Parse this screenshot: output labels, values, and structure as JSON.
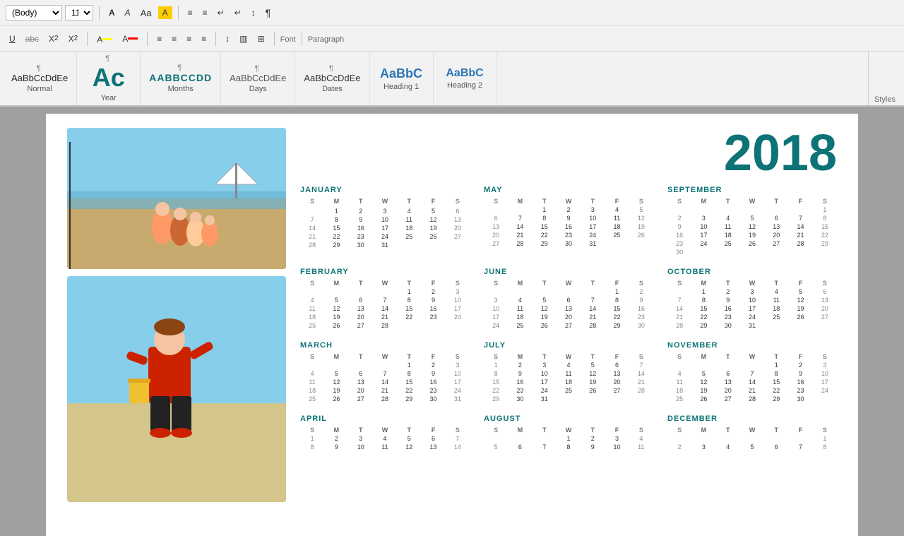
{
  "toolbar": {
    "font_family": "(Body)",
    "font_size": "11",
    "styles_label": "Styles",
    "font_label": "Font",
    "paragraph_label": "Paragraph"
  },
  "styles": [
    {
      "id": "normal",
      "preview_text": "¶ Normal",
      "label": "Normal",
      "class": "style-preview-normal"
    },
    {
      "id": "year",
      "preview_text": "¶ Year",
      "label": "Year",
      "class": "style-preview-year"
    },
    {
      "id": "months",
      "preview_text": "¶ Months",
      "label": "Months",
      "class": "style-preview-months"
    },
    {
      "id": "days",
      "preview_text": "¶ Days",
      "label": "Days",
      "class": "style-preview-days"
    },
    {
      "id": "dates",
      "preview_text": "¶ Dates",
      "label": "Dates",
      "class": "style-preview-dates"
    },
    {
      "id": "heading1",
      "preview_text": "AaBbCc",
      "label": "Heading 1",
      "class": "style-preview-heading1"
    },
    {
      "id": "heading2",
      "preview_text": "AaBbCc",
      "label": "Heading 2",
      "class": "style-preview-heading2"
    }
  ],
  "year": "2018",
  "months": [
    {
      "name": "JANUARY",
      "days": [
        "S",
        "M",
        "T",
        "W",
        "T",
        "F",
        "S"
      ],
      "weeks": [
        [
          "",
          "",
          "",
          "",
          "",
          "",
          ""
        ],
        [
          "",
          "1",
          "2",
          "3",
          "4",
          "5",
          "6"
        ],
        [
          "7",
          "8",
          "9",
          "10",
          "11",
          "12",
          "13"
        ],
        [
          "14",
          "15",
          "16",
          "17",
          "18",
          "19",
          "20"
        ],
        [
          "21",
          "22",
          "23",
          "24",
          "25",
          "26",
          "27"
        ],
        [
          "28",
          "29",
          "30",
          "31",
          "",
          "",
          ""
        ]
      ]
    },
    {
      "name": "MAY",
      "days": [
        "S",
        "M",
        "T",
        "W",
        "T",
        "F",
        "S"
      ],
      "weeks": [
        [
          "",
          "",
          "1",
          "2",
          "3",
          "4",
          "5"
        ],
        [
          "6",
          "7",
          "8",
          "9",
          "10",
          "11",
          "12"
        ],
        [
          "13",
          "14",
          "15",
          "16",
          "17",
          "18",
          "19"
        ],
        [
          "20",
          "21",
          "22",
          "23",
          "24",
          "25",
          "26"
        ],
        [
          "27",
          "28",
          "29",
          "30",
          "31",
          "",
          ""
        ]
      ]
    },
    {
      "name": "SEPTEMBER",
      "days": [
        "S",
        "M",
        "T",
        "W",
        "T",
        "F",
        "S"
      ],
      "weeks": [
        [
          "",
          "",
          "",
          "",
          "",
          "",
          "1"
        ],
        [
          "2",
          "3",
          "4",
          "5",
          "6",
          "7",
          "8"
        ],
        [
          "9",
          "10",
          "11",
          "12",
          "13",
          "14",
          "15"
        ],
        [
          "16",
          "17",
          "18",
          "19",
          "20",
          "21",
          "22"
        ],
        [
          "23",
          "24",
          "25",
          "26",
          "27",
          "28",
          "29"
        ],
        [
          "30",
          "",
          "",
          "",
          "",
          "",
          ""
        ]
      ]
    },
    {
      "name": "FEBRUARY",
      "days": [
        "S",
        "M",
        "T",
        "W",
        "T",
        "F",
        "S"
      ],
      "weeks": [
        [
          "",
          "",
          "",
          "",
          "1",
          "2",
          "3"
        ],
        [
          "4",
          "5",
          "6",
          "7",
          "8",
          "9",
          "10"
        ],
        [
          "11",
          "12",
          "13",
          "14",
          "15",
          "16",
          "17"
        ],
        [
          "18",
          "19",
          "20",
          "21",
          "22",
          "23",
          "24"
        ],
        [
          "25",
          "26",
          "27",
          "28",
          "",
          "",
          ""
        ]
      ]
    },
    {
      "name": "JUNE",
      "days": [
        "S",
        "M",
        "T",
        "W",
        "T",
        "F",
        "S"
      ],
      "weeks": [
        [
          "",
          "",
          "",
          "",
          "",
          "1",
          "2"
        ],
        [
          "3",
          "4",
          "5",
          "6",
          "7",
          "8",
          "9"
        ],
        [
          "10",
          "11",
          "12",
          "13",
          "14",
          "15",
          "16"
        ],
        [
          "17",
          "18",
          "19",
          "20",
          "21",
          "22",
          "23"
        ],
        [
          "24",
          "25",
          "26",
          "27",
          "28",
          "29",
          "30"
        ]
      ]
    },
    {
      "name": "OCTOBER",
      "days": [
        "S",
        "M",
        "T",
        "W",
        "T",
        "F",
        "S"
      ],
      "weeks": [
        [
          "",
          "1",
          "2",
          "3",
          "4",
          "5",
          "6"
        ],
        [
          "7",
          "8",
          "9",
          "10",
          "11",
          "12",
          "13"
        ],
        [
          "14",
          "15",
          "16",
          "17",
          "18",
          "19",
          "20"
        ],
        [
          "21",
          "22",
          "23",
          "24",
          "25",
          "26",
          "27"
        ],
        [
          "28",
          "29",
          "30",
          "31",
          "",
          "",
          ""
        ]
      ]
    },
    {
      "name": "MARCH",
      "days": [
        "S",
        "M",
        "T",
        "W",
        "T",
        "F",
        "S"
      ],
      "weeks": [
        [
          "",
          "",
          "",
          "",
          "1",
          "2",
          "3"
        ],
        [
          "4",
          "5",
          "6",
          "7",
          "8",
          "9",
          "10"
        ],
        [
          "11",
          "12",
          "13",
          "14",
          "15",
          "16",
          "17"
        ],
        [
          "18",
          "19",
          "20",
          "21",
          "22",
          "23",
          "24"
        ],
        [
          "25",
          "26",
          "27",
          "28",
          "29",
          "30",
          "31"
        ]
      ]
    },
    {
      "name": "JULY",
      "days": [
        "S",
        "M",
        "T",
        "W",
        "T",
        "F",
        "S"
      ],
      "weeks": [
        [
          "1",
          "2",
          "3",
          "4",
          "5",
          "6",
          "7"
        ],
        [
          "8",
          "9",
          "10",
          "11",
          "12",
          "13",
          "14"
        ],
        [
          "15",
          "16",
          "17",
          "18",
          "19",
          "20",
          "21"
        ],
        [
          "22",
          "23",
          "24",
          "25",
          "26",
          "27",
          "28"
        ],
        [
          "29",
          "30",
          "31",
          "",
          "",
          "",
          ""
        ]
      ]
    },
    {
      "name": "NOVEMBER",
      "days": [
        "S",
        "M",
        "T",
        "W",
        "T",
        "F",
        "S"
      ],
      "weeks": [
        [
          "",
          "",
          "",
          "",
          "1",
          "2",
          "3"
        ],
        [
          "4",
          "5",
          "6",
          "7",
          "8",
          "9",
          "10"
        ],
        [
          "11",
          "12",
          "13",
          "14",
          "15",
          "16",
          "17"
        ],
        [
          "18",
          "19",
          "20",
          "21",
          "22",
          "23",
          "24"
        ],
        [
          "25",
          "26",
          "27",
          "28",
          "29",
          "30",
          ""
        ]
      ]
    },
    {
      "name": "APRIL",
      "days": [
        "S",
        "M",
        "T",
        "W",
        "T",
        "F",
        "S"
      ],
      "weeks": [
        [
          "1",
          "2",
          "3",
          "4",
          "5",
          "6",
          "7"
        ],
        [
          "8",
          "9",
          "10",
          "11",
          "12",
          "13",
          "14"
        ]
      ]
    },
    {
      "name": "AUGUST",
      "days": [
        "S",
        "M",
        "T",
        "W",
        "T",
        "F",
        "S"
      ],
      "weeks": [
        [
          "",
          "",
          "",
          "1",
          "2",
          "3",
          "4"
        ],
        [
          "5",
          "6",
          "7",
          "8",
          "9",
          "10",
          "11"
        ]
      ]
    },
    {
      "name": "DECEMBER",
      "days": [
        "S",
        "M",
        "T",
        "W",
        "T",
        "F",
        "S"
      ],
      "weeks": [
        [
          "",
          "",
          "",
          "",
          "",
          "",
          "1"
        ],
        [
          "2",
          "3",
          "4",
          "5",
          "6",
          "7",
          "8"
        ]
      ]
    }
  ]
}
